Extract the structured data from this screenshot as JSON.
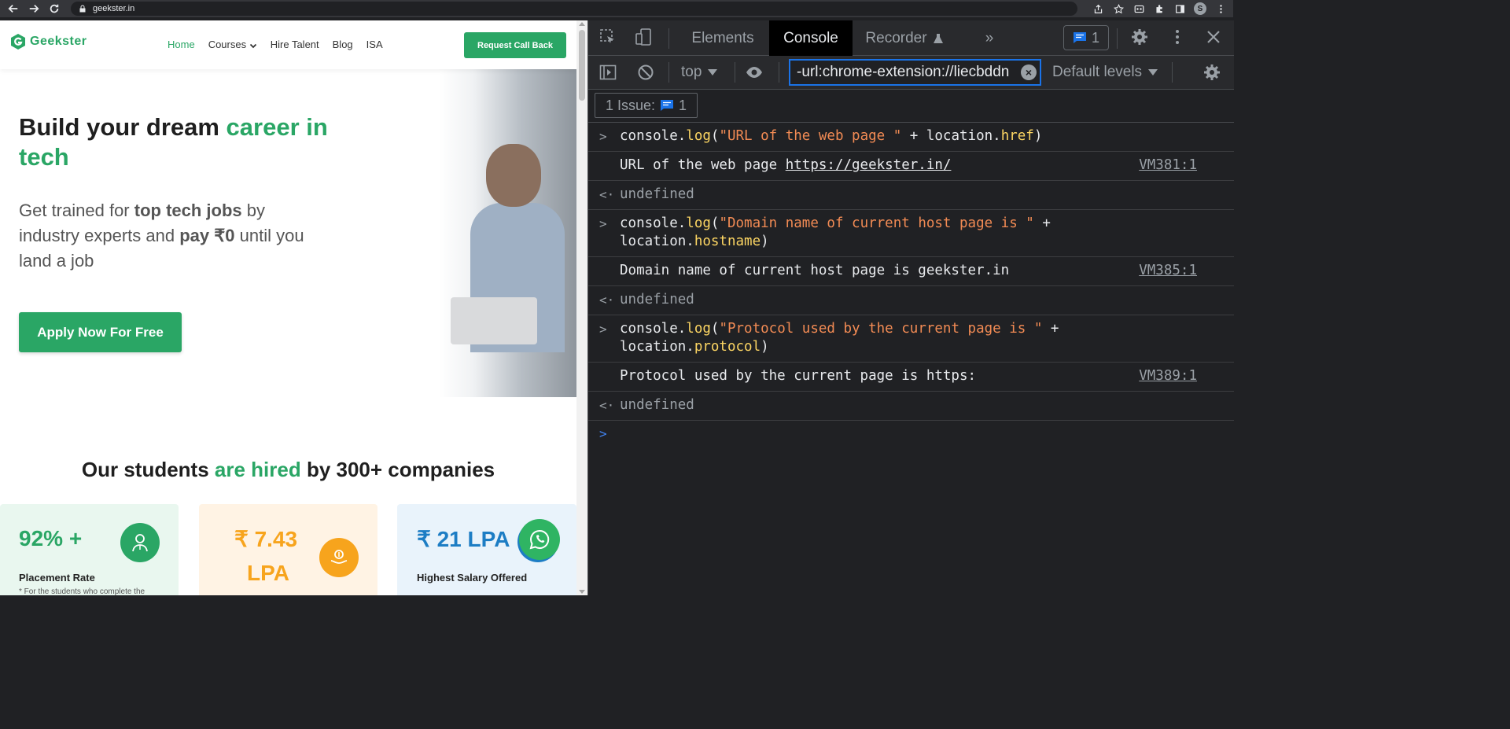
{
  "browser": {
    "url": "geekster.in",
    "profile_initial": "S",
    "icons": [
      "back-icon",
      "forward-icon",
      "reload-icon",
      "lock-icon",
      "share-icon",
      "star-icon",
      "extension-icon",
      "puzzle-icon",
      "sidepanel-icon",
      "menu-icon"
    ]
  },
  "site": {
    "logo_text": "Geekster",
    "nav": [
      {
        "label": "Home",
        "active": true
      },
      {
        "label": "Courses",
        "active": false
      },
      {
        "label": "Hire Talent",
        "active": false
      },
      {
        "label": "Blog",
        "active": false
      },
      {
        "label": "ISA",
        "active": false
      }
    ],
    "request_call_label": "Request Call Back",
    "hero_title_part1": "Build your dream ",
    "hero_title_part2": "career in tech",
    "hero_sub_1": "Get trained for ",
    "hero_sub_2": "top tech jobs",
    "hero_sub_3": " by industry experts and ",
    "hero_sub_4": "pay ₹0",
    "hero_sub_5": " until you land a job",
    "apply_label": "Apply Now For Free",
    "hired_part1": "Our students ",
    "hired_part2": "are hired",
    "hired_part3": " by 300+ companies",
    "stats": [
      {
        "value": "92% +",
        "label": "Placement Rate",
        "note": "* For the students who complete the"
      },
      {
        "value_line1": "₹ 7.43",
        "value_line2": "LPA"
      },
      {
        "value": "₹ 21 LPA",
        "label": "Highest Salary Offered"
      }
    ],
    "colors": {
      "brand_green": "#2aa665",
      "orange": "#f7a41d",
      "blue": "#1d7dc4"
    }
  },
  "devtools": {
    "tabs": [
      "Elements",
      "Console",
      "Recorder",
      "»"
    ],
    "active_tab": "Console",
    "issues_count": "1",
    "context": "top",
    "filter_value": "-url:chrome-extension://liecbddn",
    "levels": "Default levels",
    "issues_label": "1 Issue:",
    "issues_pill_count": "1",
    "entries": [
      {
        "type": "input",
        "code": {
          "p1": "console.",
          "p2": "log",
          "p3": "(",
          "p4": "\"URL of the web page \"",
          "p5": " + location.",
          "p6": "href",
          "p7": ")"
        }
      },
      {
        "type": "output",
        "text": "URL of the web page ",
        "link": "https://geekster.in/",
        "source": "VM381:1"
      },
      {
        "type": "return",
        "text": "undefined"
      },
      {
        "type": "input",
        "code": {
          "p1": "console.",
          "p2": "log",
          "p3": "(",
          "p4": "\"Domain name of current host page is \"",
          "p5": " +",
          "p6": "location.",
          "p7": "hostname",
          "p8": ")"
        }
      },
      {
        "type": "output",
        "text": "Domain name of current host page is geekster.in",
        "source": "VM385:1"
      },
      {
        "type": "return",
        "text": "undefined"
      },
      {
        "type": "input",
        "code": {
          "p1": "console.",
          "p2": "log",
          "p3": "(",
          "p4": "\"Protocol used by the current page is \"",
          "p5": " +",
          "p6": "location.",
          "p7": "protocol",
          "p8": ")"
        }
      },
      {
        "type": "output",
        "text": "Protocol used by the current page is https:",
        "source": "VM389:1"
      },
      {
        "type": "return",
        "text": "undefined"
      }
    ]
  }
}
